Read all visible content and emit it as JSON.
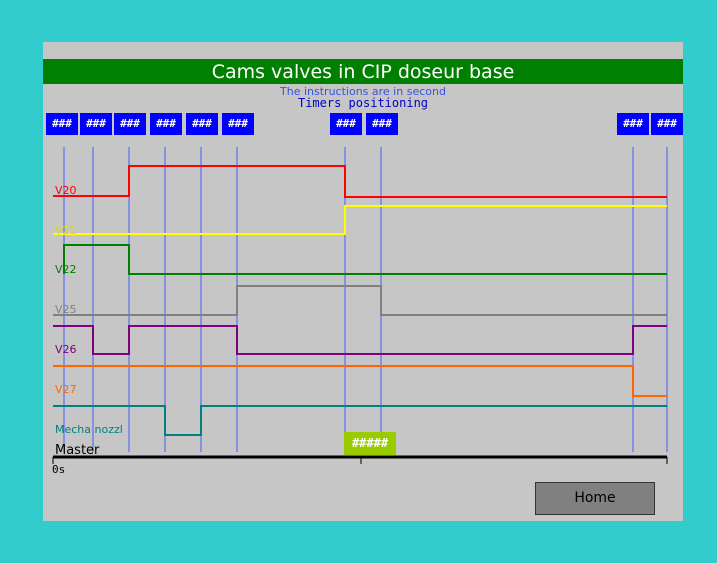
{
  "title": "Cams valves in CIP doseur base",
  "subtitle": "The instructions are in second",
  "subtitle2": "Timers positioning",
  "timer_buttons": [
    "###",
    "###",
    "###",
    "###",
    "###",
    "###",
    "###",
    "###",
    "###",
    "###"
  ],
  "signals": [
    {
      "label": "V20",
      "color": "#ff0000"
    },
    {
      "label": "V21",
      "color": "#ffff00"
    },
    {
      "label": "V22",
      "color": "#008000"
    },
    {
      "label": "V25",
      "color": "#808080"
    },
    {
      "label": "V26",
      "color": "#800080"
    },
    {
      "label": "V27",
      "color": "#ff6600"
    },
    {
      "label": "Mecha nozzl",
      "color": "#008080"
    }
  ],
  "master_label": "Master",
  "axis_start": "0s",
  "cursor_value": "#####",
  "home_label": "Home",
  "colors": {
    "background": "#33cccc",
    "panel": "#c6c6c6",
    "title_bar": "#008000",
    "timer_button": "#0000ff",
    "marker_lines": "#4060ff"
  }
}
